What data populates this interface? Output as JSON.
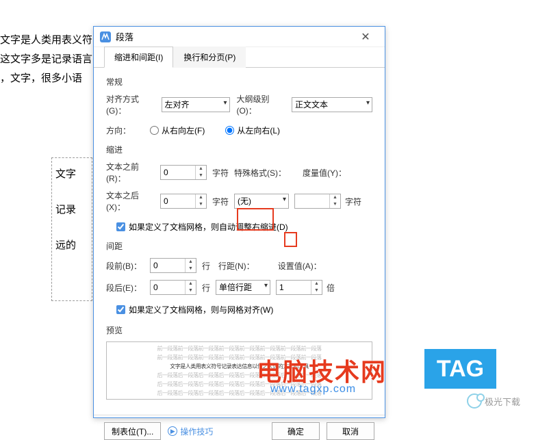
{
  "bg": {
    "l1": "文字是人类用表义符",
    "l2": "这文字多是记录语言",
    "l3": "，文字，很多小语",
    "b1": "文字",
    "b2": "记录",
    "b3": "远的"
  },
  "dialog": {
    "title": "段落",
    "close": "✕",
    "tab1": "缩进和间距(I)",
    "tab2": "换行和分页(P)"
  },
  "general": {
    "title": "常规",
    "align_label": "对齐方式(G)：",
    "align_value": "左对齐",
    "outline_label": "大纲级别(O)：",
    "outline_value": "正文文本",
    "direction_label": "方向：",
    "rtl": "从右向左(F)",
    "ltr": "从左向右(L)"
  },
  "indent": {
    "title": "缩进",
    "before_label": "文本之前(R)：",
    "before_val": "0",
    "after_label": "文本之后(X)：",
    "after_val": "0",
    "unit": "字符",
    "special_label": "特殊格式(S)：",
    "special_val": "(无)",
    "measure_label": "度量值(Y)：",
    "measure_val": "",
    "auto_adjust": "如果定义了文档网格，则自动调整右缩进(D)"
  },
  "spacing": {
    "title": "间距",
    "before_label": "段前(B)：",
    "before_val": "0",
    "after_label": "段后(E)：",
    "after_val": "0",
    "unit": "行",
    "linespace_label": "行距(N)：",
    "linespace_val": "单倍行距",
    "setvalue_label": "设置值(A)：",
    "setvalue_val": "1",
    "setvalue_unit": "倍",
    "snap_grid": "如果定义了文档网格，则与网格对齐(W)"
  },
  "preview": {
    "title": "预览",
    "sample": "文字是人类用表义符号记录表达信息以传之久远的方式和工具"
  },
  "footer": {
    "tabstop": "制表位(T)...",
    "tips": "操作技巧",
    "ok": "确定",
    "cancel": "取消"
  },
  "overlay": {
    "wm1": "电脑技术网",
    "wm1sub": "www.tagxp.com",
    "tag": "TAG",
    "jg": "极光下载"
  }
}
